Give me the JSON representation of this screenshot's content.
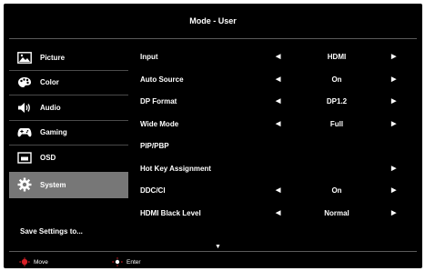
{
  "title": "Mode - User",
  "sidebar": {
    "items": [
      {
        "label": "Picture",
        "icon": "picture-icon"
      },
      {
        "label": "Color",
        "icon": "palette-icon"
      },
      {
        "label": "Audio",
        "icon": "speaker-icon"
      },
      {
        "label": "Gaming",
        "icon": "gamepad-icon"
      },
      {
        "label": "OSD",
        "icon": "osd-icon"
      },
      {
        "label": "System",
        "icon": "gear-icon",
        "selected": true
      }
    ],
    "save_label": "Save Settings to..."
  },
  "settings": [
    {
      "label": "Input",
      "value": "HDMI",
      "left_arrow": true,
      "right_arrow": true
    },
    {
      "label": "Auto Source",
      "value": "On",
      "left_arrow": true,
      "right_arrow": true
    },
    {
      "label": "DP Format",
      "value": "DP1.2",
      "left_arrow": true,
      "right_arrow": true
    },
    {
      "label": "Wide Mode",
      "value": "Full",
      "left_arrow": true,
      "right_arrow": true
    },
    {
      "label": "PIP/PBP",
      "value": "",
      "left_arrow": false,
      "right_arrow": false
    },
    {
      "label": "Hot Key Assignment",
      "value": "",
      "left_arrow": false,
      "right_arrow": true
    },
    {
      "label": "DDC/CI",
      "value": "On",
      "left_arrow": true,
      "right_arrow": true
    },
    {
      "label": "HDMI Black Level",
      "value": "Normal",
      "left_arrow": true,
      "right_arrow": true
    }
  ],
  "footer": {
    "move_label": "Move",
    "enter_label": "Enter"
  },
  "colors": {
    "background": "#000000",
    "selected": "#777777",
    "key_accent": "#d81f26"
  }
}
